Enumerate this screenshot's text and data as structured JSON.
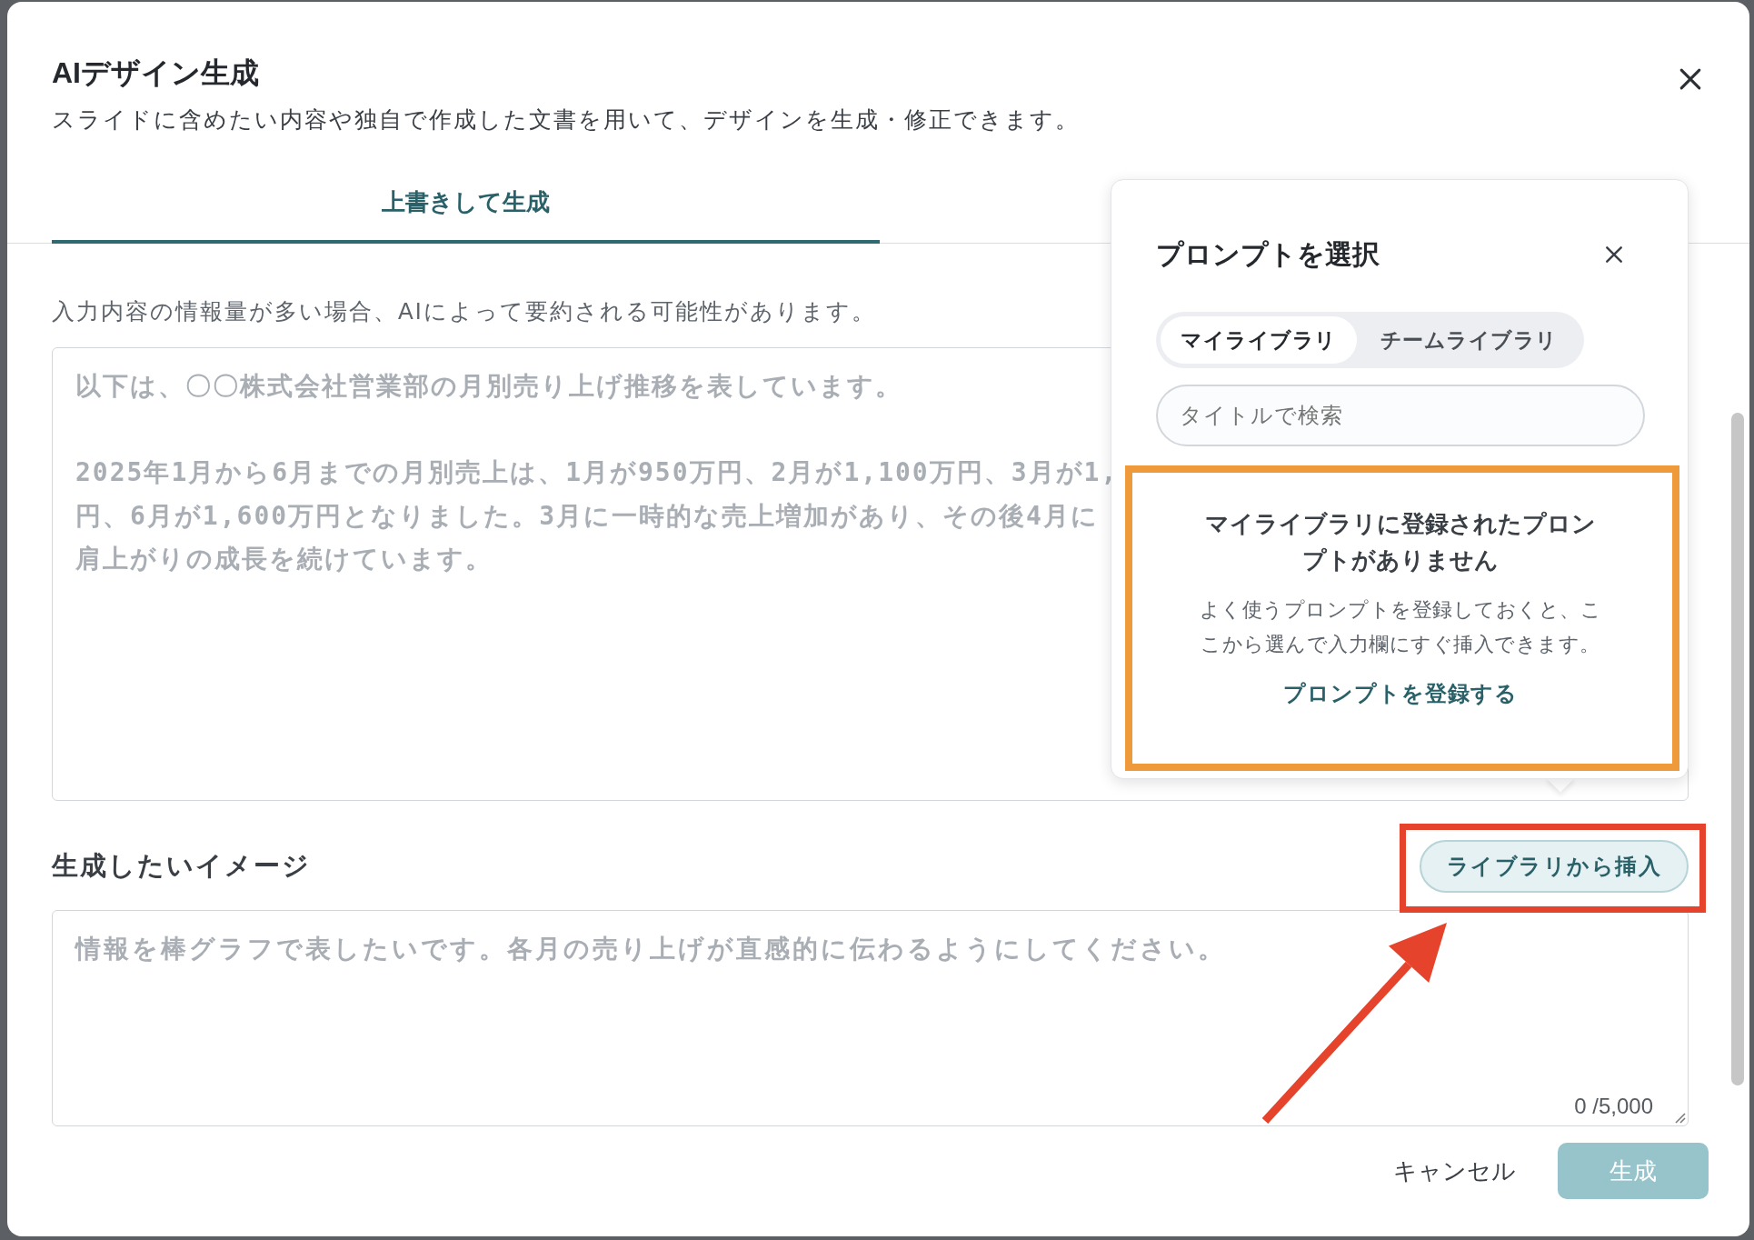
{
  "dialog": {
    "title": "AIデザイン生成",
    "description": "スライドに含めたい内容や独自で作成した文書を用いて、デザインを生成・修正できます。"
  },
  "tabs": [
    {
      "label": "上書きして生成",
      "selected": true
    }
  ],
  "content_field": {
    "hint": "入力内容の情報量が多い場合、AIによって要約される可能性があります。",
    "placeholder_paragraphs": [
      [
        "以下は、〇〇株式会社営業部の月別売り上げ推移を表しています。"
      ],
      [
        "2025年1月から6月までの月別売上は、1月が950万円、2月が1,100万円、3月が1,",
        "円、6月が1,600万円となりました。3月に一時的な売上増加があり、その後4月に",
        "肩上がりの成長を続けています。"
      ]
    ]
  },
  "image_field": {
    "label": "生成したいイメージ",
    "insert_button": "ライブラリから挿入",
    "placeholder": "情報を棒グラフで表したいです。各月の売り上げが直感的に伝わるようにしてください。",
    "counter": "0 /5,000"
  },
  "footer": {
    "cancel": "キャンセル",
    "submit": {
      "label": "生成",
      "disabled": true
    }
  },
  "prompt_popup": {
    "title": "プロンプトを選択",
    "segments": [
      {
        "label": "マイライブラリ",
        "selected": true
      },
      {
        "label": "チームライブラリ",
        "selected": false
      }
    ],
    "search": {
      "placeholder": "タイトルで検索"
    },
    "empty_state": {
      "heading": "マイライブラリに登録されたプロンプトがありません",
      "body": "よく使うプロンプトを登録しておくと、ここから選んで入力欄にすぐ挿入できます。",
      "link": "プロンプトを登録する"
    }
  },
  "annotations": [
    {
      "kind": "frame",
      "color": "#ee9a3a"
    },
    {
      "kind": "frame",
      "color": "#e5432b"
    },
    {
      "kind": "arrow",
      "color": "#e5432b"
    }
  ]
}
